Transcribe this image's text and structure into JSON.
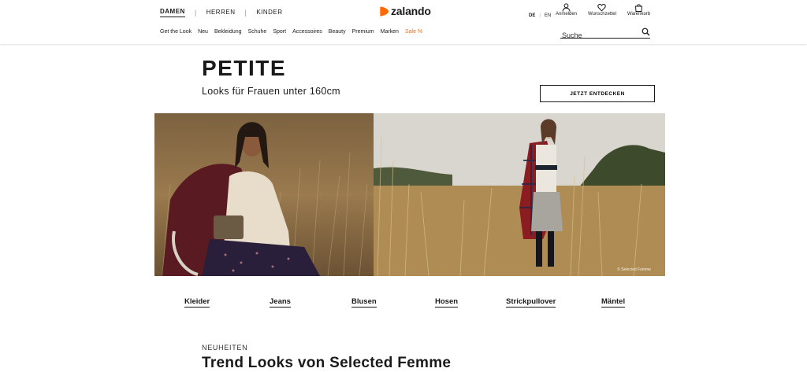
{
  "header": {
    "gender_nav": [
      {
        "label": "DAMEN",
        "active": true
      },
      {
        "label": "HERREN",
        "active": false
      },
      {
        "label": "KINDER",
        "active": false
      }
    ],
    "separator": "|",
    "logo_text": "zalando",
    "brand_color": "#ff6900",
    "languages": {
      "active": "DE",
      "other": "EN"
    },
    "tools": [
      {
        "label": "Anmelden",
        "icon": "user-icon"
      },
      {
        "label": "Wunschzettel",
        "icon": "heart-icon"
      },
      {
        "label": "Warenkorb",
        "icon": "bag-icon"
      }
    ],
    "categories": [
      "Get the Look",
      "Neu",
      "Bekleidung",
      "Schuhe",
      "Sport",
      "Accessoires",
      "Beauty",
      "Premium",
      "Marken",
      "Sale %"
    ],
    "sale_color": "#ff6900",
    "search_placeholder": "Suche"
  },
  "promo": {
    "title": "PETITE",
    "subtitle": "Looks für Frauen unter 160cm",
    "cta_label": "JETZT ENTDECKEN",
    "image_credit": "© Selected Femme"
  },
  "category_links": [
    "Kleider",
    "Jeans",
    "Blusen",
    "Hosen",
    "Strickpullover",
    "Mäntel"
  ],
  "section": {
    "eyebrow": "NEUHEITEN",
    "title": "Trend Looks von Selected Femme"
  }
}
